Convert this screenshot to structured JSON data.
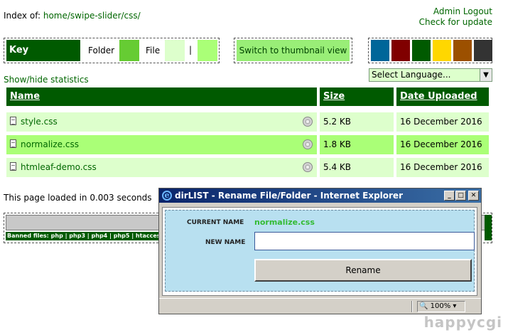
{
  "index": {
    "prefix": "Index of:",
    "path": "home/swipe-slider/css/"
  },
  "admin": {
    "logout": "Admin Logout",
    "update": "Check for update"
  },
  "key": {
    "title": "Key",
    "folder": "Folder",
    "file": "File",
    "separator": "|",
    "colors": {
      "folder": "#66cc33",
      "file": "#ddffcc",
      "highlight": "#aaff77"
    }
  },
  "thumbnail_button": "Switch to thumbnail view",
  "theme_colors": [
    "#006699",
    "#800000",
    "#005a00",
    "#ffd700",
    "#9c5000",
    "#333333"
  ],
  "language_select": {
    "selected": "Select Language..."
  },
  "stats_link": "Show/hide statistics",
  "table": {
    "headers": {
      "name": "Name",
      "size": "Size",
      "date": "Date Uploaded"
    },
    "rows": [
      {
        "name": "style.css",
        "size": "5.2 KB",
        "date": "16 December 2016"
      },
      {
        "name": "normalize.css",
        "size": "1.8 KB",
        "date": "16 December 2016"
      },
      {
        "name": "htmleaf-demo.css",
        "size": "5.4 KB",
        "date": "16 December 2016"
      }
    ]
  },
  "loaded_text": "This page loaded in 0.003 seconds",
  "banned_text": "Banned files: php | php3 | php4 | php5 | htacces",
  "popup": {
    "title": "dirLIST - Rename File/Folder - Internet Explorer",
    "current_name_label": "CURRENT NAME",
    "current_name_value": "normalize.css",
    "new_name_label": "NEW NAME",
    "new_name_value": "",
    "rename_button": "Rename",
    "zoom": "100%"
  },
  "watermark": "happycgi"
}
